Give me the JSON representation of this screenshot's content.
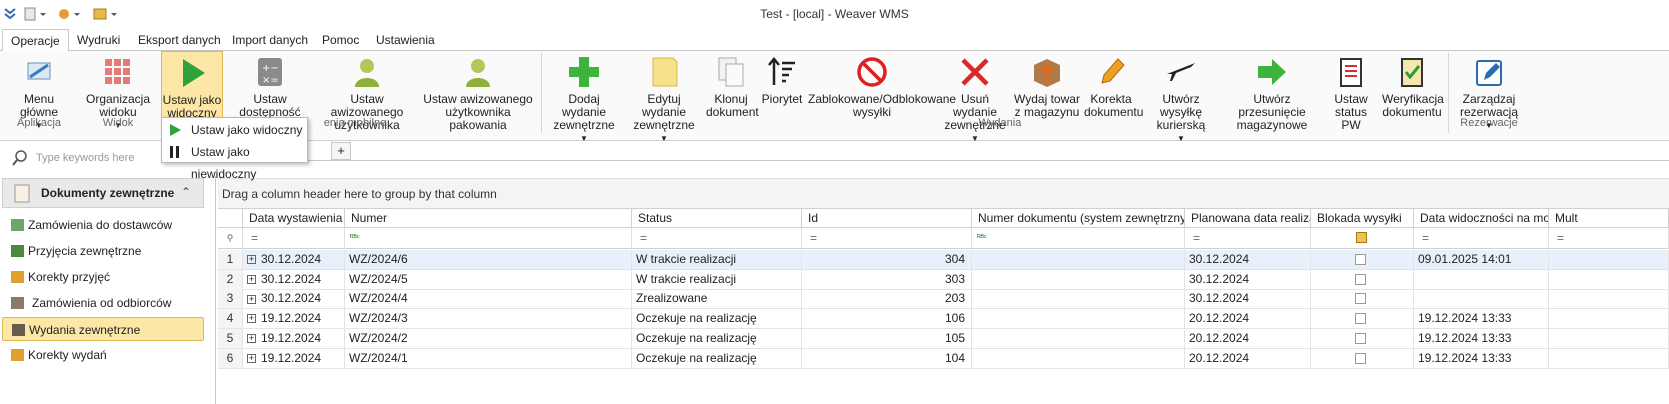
{
  "window": {
    "title": "Test - [local] - Weaver WMS"
  },
  "tabs": [
    "Operacje",
    "Wydruki",
    "Eksport danych",
    "Import danych",
    "Pomoc",
    "Ustawienia"
  ],
  "ribbon": {
    "menu_glowne": "Menu główne",
    "organizacja_widoku": "Organizacja\nwidoku",
    "ustaw_jako_widoczny": "Ustaw jako\nwidoczny",
    "ustaw_dostepnosc": "Ustaw dostępność\ntowaru",
    "ustaw_awizowanego": "Ustaw awizowanego\nużytkownika",
    "ustaw_awizowanego_pak": "Ustaw awizowanego\nużytkownika pakowania",
    "dodaj_wydanie": "Dodaj wydanie\nzewnętrzne",
    "edytuj_wydanie": "Edytuj wydanie\nzewnętrzne",
    "klonuj": "Klonuj\ndokument",
    "piorytet": "Piorytet",
    "zablokowane": "Zablokowane/Odblokowane\nwysyłki",
    "usun_wydanie": "Usuń wydanie\nzewnętrzne",
    "wydaj_towar": "Wydaj towar\nz magazynu",
    "korekta": "Korekta\ndokumentu",
    "utworz_wysylke": "Utwórz wysyłkę\nkurierską",
    "utworz_przesuniecie": "Utwórz przesunięcie\nmagazynowe",
    "ustaw_status_pw": "Ustaw\nstatus PW",
    "weryfikacja": "Weryfikacja\ndokumentu",
    "zarzadzaj": "Zarządzaj\nrezerwacją",
    "groups": {
      "aplikacja": "Aplikacja",
      "widok": "Widok",
      "urzadzenia": "enia mobilne",
      "wydania": "Wydania",
      "rezerwacje": "Rezerwacje"
    }
  },
  "dropdown": {
    "item1": "Ustaw jako widoczny",
    "item2": "Ustaw jako niewidoczny"
  },
  "nav": {
    "search_placeholder": "Type keywords here",
    "section": "Dokumenty zewnętrzne",
    "items": [
      "Zamówienia do dostawców",
      "Przyjęcia zewnętrzne",
      "Korekty przyjęć",
      "Zamówienia od odbiorców",
      "Wydania zewnętrzne",
      "Korekty wydań"
    ]
  },
  "grid": {
    "add_tab": "+",
    "group_hint": "Drag a column header here to group by that column",
    "columns": [
      "Data wystawienia",
      "Numer",
      "Status",
      "Id",
      "Numer dokumentu (system zewnętrzny)",
      "Planowana data realizacji",
      "Blokada wysyłki",
      "Data widoczności na mobil...",
      "Mult"
    ],
    "rows": [
      {
        "n": "1",
        "data": "30.12.2024",
        "numer": "WZ/2024/6",
        "status": "W trakcie realizacji",
        "id": "304",
        "plan": "30.12.2024",
        "widok": "09.01.2025 14:01"
      },
      {
        "n": "2",
        "data": "30.12.2024",
        "numer": "WZ/2024/5",
        "status": "W trakcie realizacji",
        "id": "303",
        "plan": "30.12.2024",
        "widok": ""
      },
      {
        "n": "3",
        "data": "30.12.2024",
        "numer": "WZ/2024/4",
        "status": "Zrealizowane",
        "id": "203",
        "plan": "30.12.2024",
        "widok": ""
      },
      {
        "n": "4",
        "data": "19.12.2024",
        "numer": "WZ/2024/3",
        "status": "Oczekuje na realizację",
        "id": "106",
        "plan": "20.12.2024",
        "widok": "19.12.2024 13:33"
      },
      {
        "n": "5",
        "data": "19.12.2024",
        "numer": "WZ/2024/2",
        "status": "Oczekuje na realizację",
        "id": "105",
        "plan": "20.12.2024",
        "widok": "19.12.2024 13:33"
      },
      {
        "n": "6",
        "data": "19.12.2024",
        "numer": "WZ/2024/1",
        "status": "Oczekuje na realizację",
        "id": "104",
        "plan": "20.12.2024",
        "widok": "19.12.2024 13:33"
      }
    ]
  }
}
